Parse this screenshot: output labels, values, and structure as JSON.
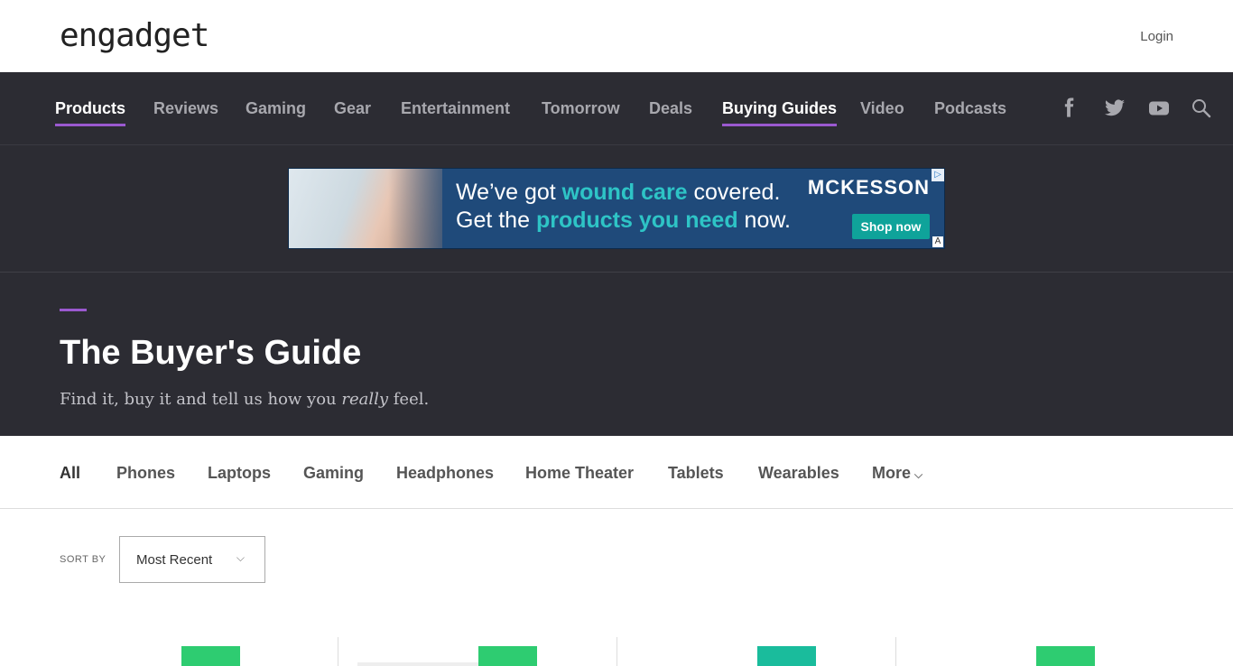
{
  "header": {
    "logo_text": "engadget",
    "login_label": "Login"
  },
  "nav": {
    "items": [
      {
        "label": "Products",
        "active": true
      },
      {
        "label": "Reviews",
        "active": false
      },
      {
        "label": "Gaming",
        "active": false
      },
      {
        "label": "Gear",
        "active": false
      },
      {
        "label": "Entertainment",
        "active": false
      },
      {
        "label": "Tomorrow",
        "active": false
      },
      {
        "label": "Deals",
        "active": false
      },
      {
        "label": "Buying Guides",
        "active": true
      },
      {
        "label": "Video",
        "active": false
      },
      {
        "label": "Podcasts",
        "active": false
      }
    ],
    "social": [
      "facebook-icon",
      "twitter-icon",
      "youtube-icon",
      "search-icon"
    ]
  },
  "ad": {
    "line1_a": "We’ve got ",
    "line1_hl": "wound care",
    "line1_b": " covered.",
    "line2_a": "Get the ",
    "line2_hl": "products you need",
    "line2_b": " now.",
    "brand": "MCKESSON",
    "button": "Shop now",
    "choice_icon": "▷",
    "badge": "A"
  },
  "hero": {
    "title": "The Buyer's Guide",
    "subtitle_a": "Find it, buy it and tell us how you ",
    "subtitle_em": "really",
    "subtitle_b": " feel."
  },
  "categories": {
    "items": [
      "All",
      "Phones",
      "Laptops",
      "Gaming",
      "Headphones",
      "Home Theater",
      "Tablets",
      "Wearables",
      "More"
    ]
  },
  "sort": {
    "label": "SORT BY",
    "value": "Most Recent"
  },
  "colors": {
    "accent": "#9b59d0",
    "nav_bg": "#2c2c33",
    "tag_green": "#2ecc71",
    "tag_teal": "#1abc9c"
  }
}
